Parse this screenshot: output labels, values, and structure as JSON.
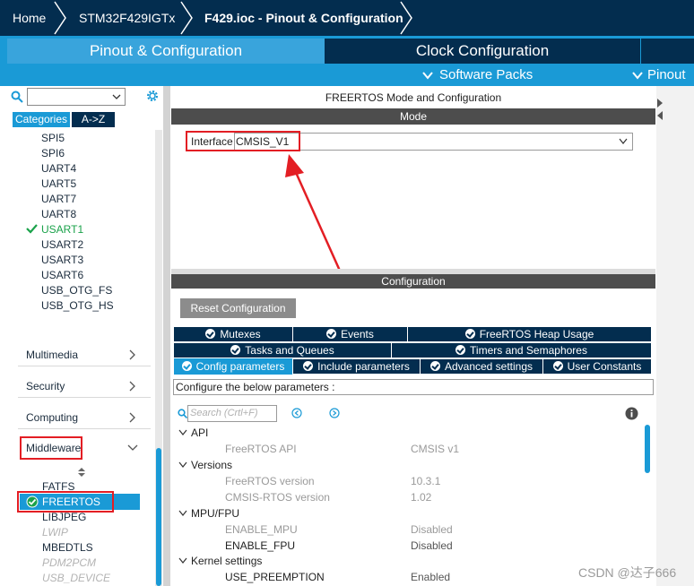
{
  "breadcrumb": [
    "Home",
    "STM32F429IGTx",
    "F429.ioc - Pinout & Configuration"
  ],
  "tabs": {
    "pinout": "Pinout & Configuration",
    "clock": "Clock Configuration"
  },
  "submenus": {
    "software_packs": "Software Packs",
    "pinout": "Pinout"
  },
  "left": {
    "cat_tabs": [
      "Categories",
      "A->Z"
    ],
    "peripherals": [
      "SPI5",
      "SPI6",
      "UART4",
      "UART5",
      "UART7",
      "UART8",
      "USART1",
      "USART2",
      "USART3",
      "USART6",
      "USB_OTG_FS",
      "USB_OTG_HS"
    ],
    "active_peripheral": "USART1",
    "groups": [
      "Multimedia",
      "Security",
      "Computing",
      "Middleware"
    ],
    "middleware": [
      "FATFS",
      "FREERTOS",
      "LIBJPEG",
      "LWIP",
      "MBEDTLS",
      "PDM2PCM",
      "USB_DEVICE"
    ]
  },
  "mode": {
    "header": "FREERTOS Mode and Configuration",
    "bar": "Mode",
    "interface_label": "Interface",
    "interface_value": "CMSIS_V1"
  },
  "config": {
    "bar": "Configuration",
    "reset": "Reset Configuration",
    "tabs_row1": [
      "Mutexes",
      "Events",
      "FreeRTOS Heap Usage"
    ],
    "tabs_row2": [
      "Tasks and Queues",
      "Timers and Semaphores"
    ],
    "tabs_row3": [
      "Config parameters",
      "Include parameters",
      "Advanced settings",
      "User Constants"
    ],
    "description": "Configure the below parameters :",
    "search_placeholder": "Search (Crtl+F)",
    "groups": [
      {
        "name": "API",
        "params": [
          {
            "name": "FreeRTOS API",
            "value": "CMSIS v1",
            "dim": true
          }
        ]
      },
      {
        "name": "Versions",
        "params": [
          {
            "name": "FreeRTOS version",
            "value": "10.3.1",
            "dim": true
          },
          {
            "name": "CMSIS-RTOS version",
            "value": "1.02",
            "dim": true
          }
        ]
      },
      {
        "name": "MPU/FPU",
        "params": [
          {
            "name": "ENABLE_MPU",
            "value": "Disabled",
            "dim": true
          },
          {
            "name": "ENABLE_FPU",
            "value": "Disabled",
            "dim": false
          }
        ]
      },
      {
        "name": "Kernel settings",
        "params": [
          {
            "name": "USE_PREEMPTION",
            "value": "Enabled",
            "dim": false
          }
        ]
      }
    ]
  },
  "watermark": "CSDN @达子666"
}
